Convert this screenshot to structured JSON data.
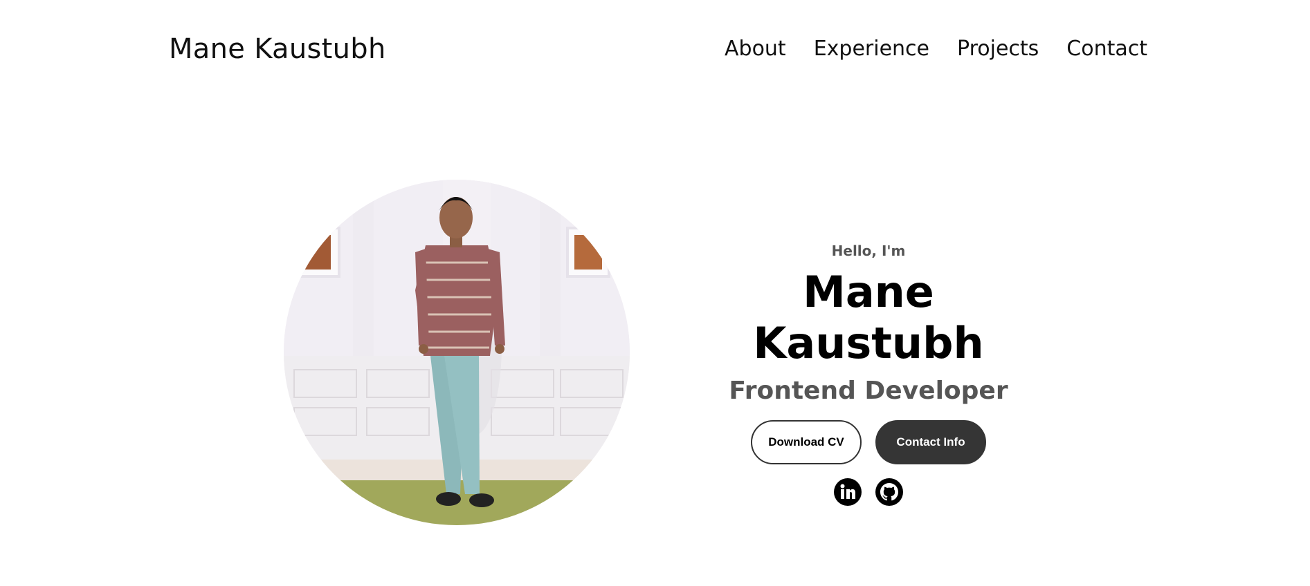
{
  "nav": {
    "logo": "Mane Kaustubh",
    "links": [
      "About",
      "Experience",
      "Projects",
      "Contact"
    ]
  },
  "hero": {
    "photo_icon": "profile-photo",
    "greeting": "Hello, I'm",
    "name": "Mane Kaustubh",
    "role": "Frontend Developer",
    "buttons": {
      "download": "Download CV",
      "contact": "Contact Info"
    },
    "socials": [
      {
        "icon": "linkedin-icon"
      },
      {
        "icon": "github-icon"
      }
    ]
  },
  "colors": {
    "text": "#000000",
    "muted": "#555555",
    "button_dark": "#353535",
    "background": "#ffffff"
  }
}
